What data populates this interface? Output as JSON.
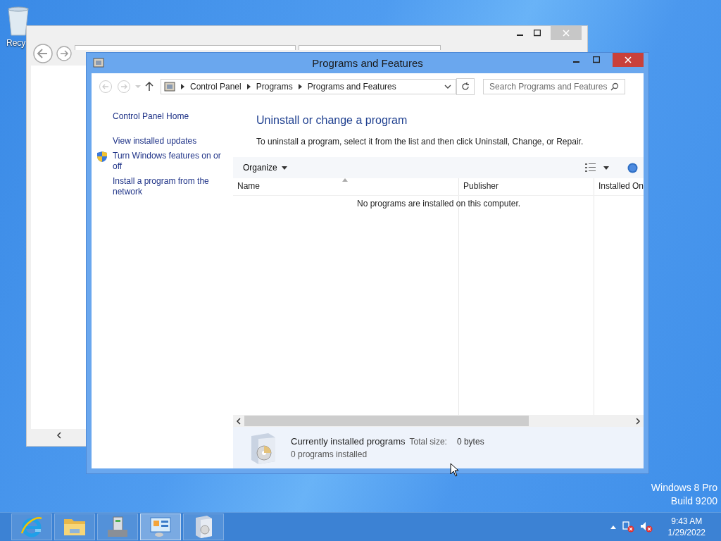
{
  "desktop": {
    "icons": [
      {
        "label": "Recy"
      }
    ],
    "watermark": [
      "Windows 8 Pro",
      "Build 9200"
    ]
  },
  "window": {
    "title": "Programs and Features",
    "breadcrumb": [
      "Control Panel",
      "Programs",
      "Programs and Features"
    ],
    "search": {
      "placeholder": "Search Programs and Features"
    },
    "sidebar": {
      "home": "Control Panel Home",
      "links": [
        {
          "label": "View installed updates",
          "kind": "link"
        },
        {
          "label": "Turn Windows features on or off",
          "kind": "shield"
        },
        {
          "label": "Install a program from the network",
          "kind": "link"
        }
      ]
    },
    "heading": "Uninstall or change a program",
    "instructions": "To uninstall a program, select it from the list and then click Uninstall, Change, or Repair.",
    "toolbar": {
      "organize": "Organize"
    },
    "table": {
      "columns": [
        {
          "label": "Name",
          "sorted": true
        },
        {
          "label": "Publisher",
          "sorted": false
        },
        {
          "label": "Installed On",
          "sorted": false
        }
      ],
      "empty_message": "No programs are installed on this computer."
    },
    "details": {
      "title": "Currently installed programs",
      "total_size_label": "Total size:",
      "total_size": "0 bytes",
      "count": "0 programs installed"
    }
  },
  "taskbar": {
    "apps": [
      {
        "kind": "browser",
        "selected": false
      },
      {
        "kind": "folder",
        "selected": false
      },
      {
        "kind": "server",
        "selected": false
      },
      {
        "kind": "control",
        "selected": true
      },
      {
        "kind": "installer",
        "selected": false
      }
    ],
    "clock": {
      "time": "9:43 AM",
      "date": "1/29/2022"
    }
  }
}
